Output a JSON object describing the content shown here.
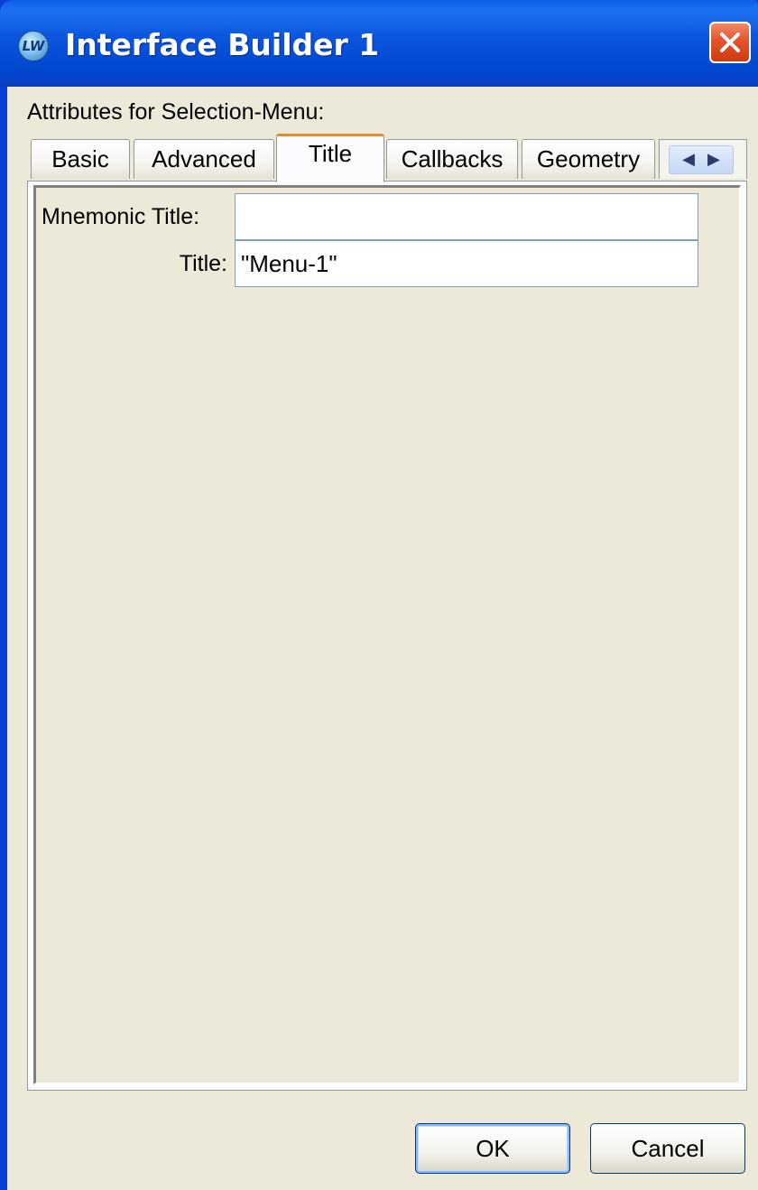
{
  "window": {
    "title": "Interface Builder 1",
    "app_icon_text": "LW"
  },
  "dialog": {
    "caption": "Attributes for Selection-Menu:"
  },
  "tabs": [
    {
      "label": "Basic",
      "active": false
    },
    {
      "label": "Advanced",
      "active": false
    },
    {
      "label": "Title",
      "active": true
    },
    {
      "label": "Callbacks",
      "active": false
    },
    {
      "label": "Geometry",
      "active": false
    }
  ],
  "tab_scroll": {
    "left_arrow": "◀",
    "right_arrow": "▶"
  },
  "fields": {
    "mnemonic_title": {
      "label": "Mnemonic Title:",
      "value": ""
    },
    "title": {
      "label": "Title:",
      "value": "\"Menu-1\""
    }
  },
  "buttons": {
    "ok_label": "OK",
    "cancel_label": "Cancel"
  },
  "colors": {
    "titlebar": "#0a54dc",
    "active_tab_accent": "#e68b2c",
    "dialog_background": "#ece9d8"
  }
}
